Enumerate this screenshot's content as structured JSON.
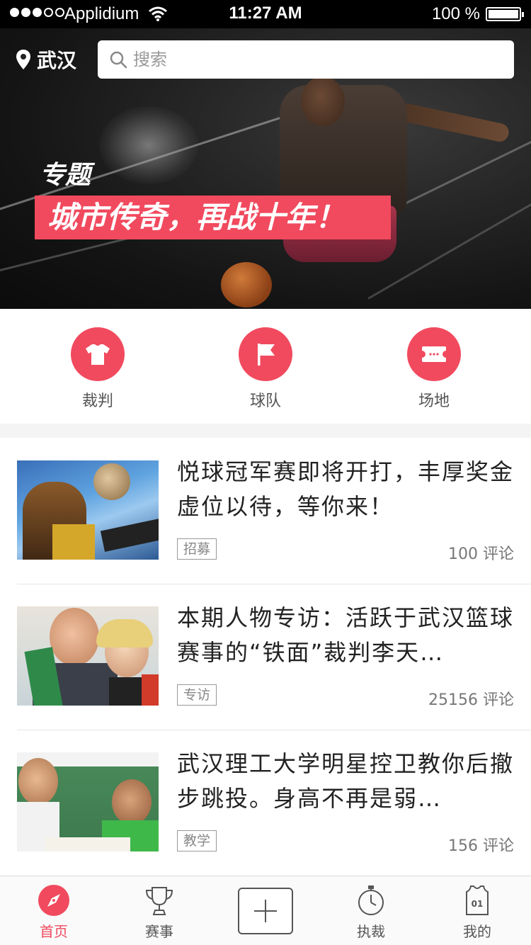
{
  "status_bar": {
    "carrier": "Applidium",
    "time": "11:27 AM",
    "battery": "100 %",
    "signal_bars": 3,
    "signal_total": 5,
    "battery_level": 1.0
  },
  "header": {
    "city": "武汉",
    "search_placeholder": "搜索"
  },
  "banner": {
    "tag": "专题",
    "headline": "城市传奇，再战十年！"
  },
  "categories": [
    {
      "label": "裁判",
      "icon": "shirt-icon"
    },
    {
      "label": "球队",
      "icon": "flag-icon"
    },
    {
      "label": "场地",
      "icon": "court-icon"
    }
  ],
  "news": [
    {
      "title": "悦球冠军赛即将开打，丰厚奖金虚位以待，等你来！",
      "tag": "招募",
      "comments": "100 评论",
      "thumb": "basketball-player-thumb"
    },
    {
      "title": "本期人物专访：活跃于武汉篮球赛事的“铁面”裁判李天…",
      "tag": "专访",
      "comments": "25156 评论",
      "thumb": "referee-portrait-thumb"
    },
    {
      "title": "武汉理工大学明星控卫教你后撤步跳投。身高不再是弱…",
      "tag": "教学",
      "comments": "156 评论",
      "thumb": "classroom-thumb"
    }
  ],
  "tab_bar": {
    "tabs": [
      {
        "label": "首页",
        "icon": "compass-icon",
        "active": true
      },
      {
        "label": "赛事",
        "icon": "trophy-icon",
        "active": false
      },
      {
        "label": "",
        "icon": "add-icon",
        "active": false
      },
      {
        "label": "执裁",
        "icon": "stopwatch-icon",
        "active": false
      },
      {
        "label": "我的",
        "icon": "jersey-icon",
        "active": false
      }
    ]
  },
  "colors": {
    "accent": "#f14a5e",
    "text_primary": "#222222",
    "text_secondary": "#777777",
    "status_bar_bg": "#000000"
  }
}
